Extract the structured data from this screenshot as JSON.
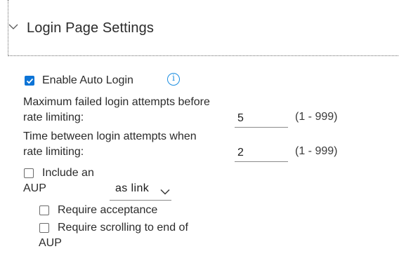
{
  "section": {
    "title": "Login Page Settings"
  },
  "auto_login": {
    "label": "Enable Auto Login",
    "checked": true,
    "info_symbol": "i"
  },
  "max_failed": {
    "label_line1": "Maximum failed login attempts before",
    "label_line2": "rate limiting:",
    "value": "5",
    "range": "(1 - 999)"
  },
  "time_between": {
    "label_line1": "Time between login attempts when",
    "label_line2": "rate limiting:",
    "value": "2",
    "range": "(1 - 999)"
  },
  "aup": {
    "label_line1": "Include an",
    "label_line2": "AUP",
    "checked": false,
    "mode_selected": "as link",
    "require_acceptance": {
      "label": "Require acceptance",
      "checked": false
    },
    "require_scrolling": {
      "label_line1": "Require scrolling to end of",
      "label_line2": "AUP",
      "checked": false
    }
  },
  "colors": {
    "accent": "#0d74d6",
    "info": "#1b8de0",
    "text": "#2b2b2b"
  },
  "icons": {
    "collapse": "chevron-down-icon",
    "info": "info-icon",
    "checkbox": "checkbox-icon"
  }
}
